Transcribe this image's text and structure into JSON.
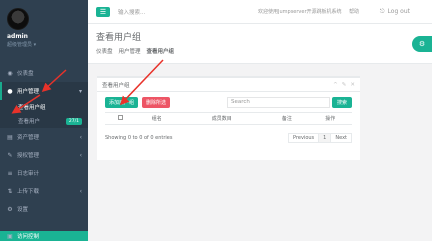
{
  "profile": {
    "name": "admin",
    "role": "超级管理员",
    "role_caret": "▾"
  },
  "sidebar": {
    "items": [
      {
        "label": "仪表盘",
        "icon": "dashboard-icon",
        "glyph": "◉"
      },
      {
        "label": "用户管理",
        "icon": "users-icon",
        "glyph": "👥",
        "arrow": "▾"
      },
      {
        "label": "资产管理",
        "icon": "assets-icon",
        "glyph": "▤",
        "arrow": "‹"
      },
      {
        "label": "授权管理",
        "icon": "perm-icon",
        "glyph": "✎",
        "arrow": "‹"
      },
      {
        "label": "日志审计",
        "icon": "audit-icon",
        "glyph": "≡"
      },
      {
        "label": "上传下载",
        "icon": "upload-icon",
        "glyph": "⇅",
        "arrow": "‹"
      },
      {
        "label": "设置",
        "icon": "gear-icon",
        "glyph": "⚙"
      },
      {
        "label": "访问控制",
        "icon": "access-icon",
        "glyph": "▣"
      }
    ],
    "sub_items": [
      {
        "label": "查看用户组"
      },
      {
        "label": "查看用户",
        "badge": "27/1"
      }
    ]
  },
  "topbar": {
    "menu_glyph": "☰",
    "search_placeholder": "输入搜索...",
    "welcome": "欢迎使用Jumpserver开源跳板机系统",
    "help": "帮助",
    "logout_glyph": "⎋",
    "logout": "Log out"
  },
  "heading": {
    "title": "查看用户组",
    "breadcrumb": [
      "仪表盘",
      "用户管理",
      "查看用户组"
    ],
    "corner_glyph": "⚙"
  },
  "panel": {
    "title": "查看用户组",
    "tools": [
      "^",
      "✎",
      "✕"
    ],
    "add_label": "添加用户组",
    "delete_label": "删除所选",
    "search_placeholder": "Search",
    "search_button": "搜索",
    "columns": [
      "组名",
      "成员数目",
      "备注",
      "操作"
    ],
    "showing": "Showing 0 to 0 of 0 entries",
    "pager": {
      "prev": "Previous",
      "page": "1",
      "next": "Next"
    }
  },
  "colors": {
    "sidebar": "#2f4050",
    "accent": "#1ab394",
    "danger": "#ed5565",
    "arrow": "#e8322a"
  }
}
